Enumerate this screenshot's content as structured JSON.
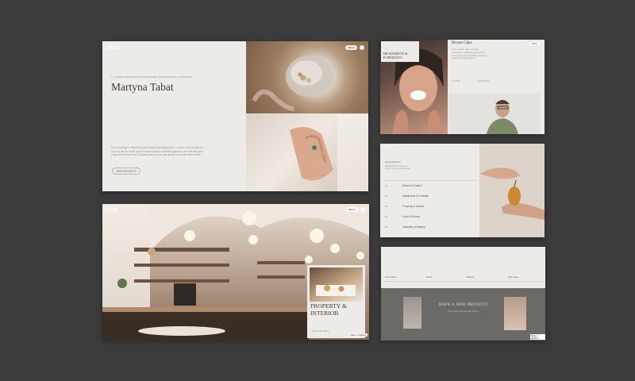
{
  "hero": {
    "logo": "tabat",
    "kicker": "A LONDON BASED PHOTOGRAPHER FOR BRANDS & CREATIVES",
    "name": "Martyna Tabat",
    "intro": "If you seeking a reliable and professional photographer in London, look no further. I love my mix for detail and a creative solution-oriented approach, and will take your project to the next level. Working with me, you get access to creative fresh skills.",
    "cta": "VIEW PROJECTS",
    "menu_chip": "MENU"
  },
  "headshots": {
    "label": "HEADSHOTS & PORTRAITS",
    "recent_title": "Recent Clips",
    "recent_text": "Lorem ipsum dolor sit amet consectetur adipiscing elit sed do eiusmod tempor incididunt ut labore et dolore magna aliqua.",
    "meta_a": "CLIENT",
    "meta_b": "LOCATION",
    "chip": "MENU"
  },
  "services": {
    "logo": "tabat",
    "intro_title": "About Martyna",
    "intro_text": "Photography services for brands, people and spaces.",
    "items": [
      {
        "num": "01",
        "label": "Brand & Product"
      },
      {
        "num": "02",
        "label": "Headshots & Portraits"
      },
      {
        "num": "03",
        "label": "Property & Interior"
      },
      {
        "num": "04",
        "label": "Food & Drinks"
      },
      {
        "num": "05",
        "label": "Jewellery & Beauty"
      }
    ]
  },
  "property": {
    "logo": "tabat",
    "title": "PROPERTY & INTERIOR",
    "chip": "MENU",
    "badge": "Made in Webflow",
    "link": "VIEW PROJECT"
  },
  "contact": {
    "fields": [
      "First Name",
      "Email",
      "Budget",
      "Start Date"
    ],
    "question": "HAVE A NEW PROJECT?",
    "sub": "Get in touch and let's talk about it.",
    "badge": "Made in Webflow"
  },
  "colors": {
    "background": "#3b3b3b",
    "panel": "#ecebe7",
    "accent_text": "#4a463f"
  }
}
